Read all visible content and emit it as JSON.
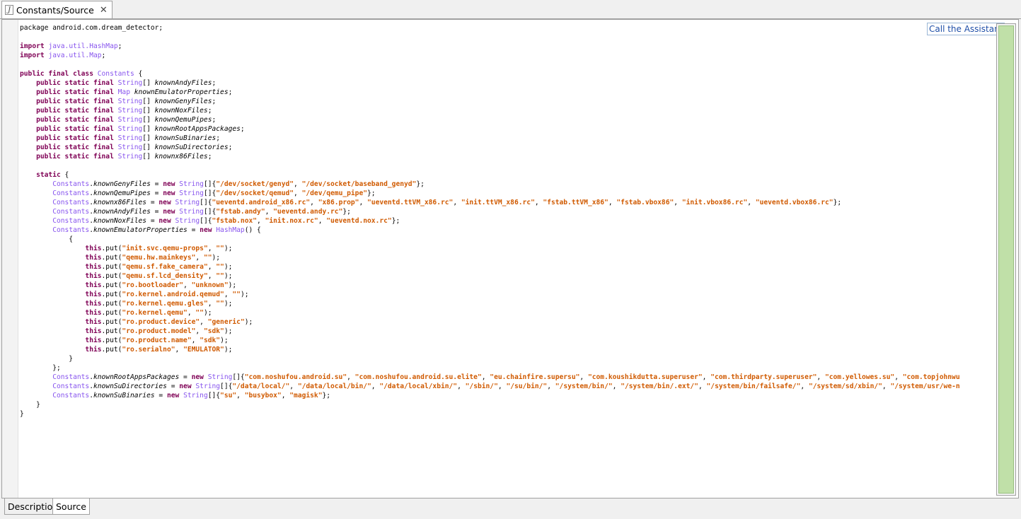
{
  "editor_tab": {
    "title": "Constants/Source",
    "icon": "java-file-icon"
  },
  "assistant": {
    "label": "Call the Assistant"
  },
  "bottom_tabs": [
    {
      "label": "Description"
    },
    {
      "label": "Source"
    }
  ],
  "code_lines": [
    [
      [
        "t",
        "package android.com.dream_detector;"
      ]
    ],
    [],
    [
      [
        "k",
        "import"
      ],
      [
        "t",
        " "
      ],
      [
        "y",
        "java.util.HashMap"
      ],
      [
        "t",
        ";"
      ]
    ],
    [
      [
        "k",
        "import"
      ],
      [
        "t",
        " "
      ],
      [
        "y",
        "java.util.Map"
      ],
      [
        "t",
        ";"
      ]
    ],
    [],
    [
      [
        "k",
        "public final class"
      ],
      [
        "t",
        " "
      ],
      [
        "y",
        "Constants"
      ],
      [
        "t",
        " {"
      ]
    ],
    [
      [
        "t",
        "    "
      ],
      [
        "k",
        "public static final"
      ],
      [
        "t",
        " "
      ],
      [
        "y",
        "String"
      ],
      [
        "t",
        "[] "
      ],
      [
        "f",
        "knownAndyFiles"
      ],
      [
        "t",
        ";"
      ]
    ],
    [
      [
        "t",
        "    "
      ],
      [
        "k",
        "public static final"
      ],
      [
        "t",
        " "
      ],
      [
        "y",
        "Map"
      ],
      [
        "t",
        " "
      ],
      [
        "f",
        "knownEmulatorProperties"
      ],
      [
        "t",
        ";"
      ]
    ],
    [
      [
        "t",
        "    "
      ],
      [
        "k",
        "public static final"
      ],
      [
        "t",
        " "
      ],
      [
        "y",
        "String"
      ],
      [
        "t",
        "[] "
      ],
      [
        "f",
        "knownGenyFiles"
      ],
      [
        "t",
        ";"
      ]
    ],
    [
      [
        "t",
        "    "
      ],
      [
        "k",
        "public static final"
      ],
      [
        "t",
        " "
      ],
      [
        "y",
        "String"
      ],
      [
        "t",
        "[] "
      ],
      [
        "f",
        "knownNoxFiles"
      ],
      [
        "t",
        ";"
      ]
    ],
    [
      [
        "t",
        "    "
      ],
      [
        "k",
        "public static final"
      ],
      [
        "t",
        " "
      ],
      [
        "y",
        "String"
      ],
      [
        "t",
        "[] "
      ],
      [
        "f",
        "knownQemuPipes"
      ],
      [
        "t",
        ";"
      ]
    ],
    [
      [
        "t",
        "    "
      ],
      [
        "k",
        "public static final"
      ],
      [
        "t",
        " "
      ],
      [
        "y",
        "String"
      ],
      [
        "t",
        "[] "
      ],
      [
        "f",
        "knownRootAppsPackages"
      ],
      [
        "t",
        ";"
      ]
    ],
    [
      [
        "t",
        "    "
      ],
      [
        "k",
        "public static final"
      ],
      [
        "t",
        " "
      ],
      [
        "y",
        "String"
      ],
      [
        "t",
        "[] "
      ],
      [
        "f",
        "knownSuBinaries"
      ],
      [
        "t",
        ";"
      ]
    ],
    [
      [
        "t",
        "    "
      ],
      [
        "k",
        "public static final"
      ],
      [
        "t",
        " "
      ],
      [
        "y",
        "String"
      ],
      [
        "t",
        "[] "
      ],
      [
        "f",
        "knownSuDirectories"
      ],
      [
        "t",
        ";"
      ]
    ],
    [
      [
        "t",
        "    "
      ],
      [
        "k",
        "public static final"
      ],
      [
        "t",
        " "
      ],
      [
        "y",
        "String"
      ],
      [
        "t",
        "[] "
      ],
      [
        "f",
        "knownx86Files"
      ],
      [
        "t",
        ";"
      ]
    ],
    [],
    [
      [
        "t",
        "    "
      ],
      [
        "k",
        "static"
      ],
      [
        "t",
        " {"
      ]
    ],
    [
      [
        "t",
        "        "
      ],
      [
        "y",
        "Constants"
      ],
      [
        "t",
        "."
      ],
      [
        "f",
        "knownGenyFiles"
      ],
      [
        "t",
        " = "
      ],
      [
        "k",
        "new"
      ],
      [
        "t",
        " "
      ],
      [
        "y",
        "String"
      ],
      [
        "t",
        "[]{"
      ],
      [
        "s",
        "\"/dev/socket/genyd\""
      ],
      [
        "t",
        ", "
      ],
      [
        "s",
        "\"/dev/socket/baseband_genyd\""
      ],
      [
        "t",
        "};"
      ]
    ],
    [
      [
        "t",
        "        "
      ],
      [
        "y",
        "Constants"
      ],
      [
        "t",
        "."
      ],
      [
        "f",
        "knownQemuPipes"
      ],
      [
        "t",
        " = "
      ],
      [
        "k",
        "new"
      ],
      [
        "t",
        " "
      ],
      [
        "y",
        "String"
      ],
      [
        "t",
        "[]{"
      ],
      [
        "s",
        "\"/dev/socket/qemud\""
      ],
      [
        "t",
        ", "
      ],
      [
        "s",
        "\"/dev/qemu_pipe\""
      ],
      [
        "t",
        "};"
      ]
    ],
    [
      [
        "t",
        "        "
      ],
      [
        "y",
        "Constants"
      ],
      [
        "t",
        "."
      ],
      [
        "f",
        "knownx86Files"
      ],
      [
        "t",
        " = "
      ],
      [
        "k",
        "new"
      ],
      [
        "t",
        " "
      ],
      [
        "y",
        "String"
      ],
      [
        "t",
        "[]{"
      ],
      [
        "s",
        "\"ueventd.android_x86.rc\""
      ],
      [
        "t",
        ", "
      ],
      [
        "s",
        "\"x86.prop\""
      ],
      [
        "t",
        ", "
      ],
      [
        "s",
        "\"ueventd.ttVM_x86.rc\""
      ],
      [
        "t",
        ", "
      ],
      [
        "s",
        "\"init.ttVM_x86.rc\""
      ],
      [
        "t",
        ", "
      ],
      [
        "s",
        "\"fstab.ttVM_x86\""
      ],
      [
        "t",
        ", "
      ],
      [
        "s",
        "\"fstab.vbox86\""
      ],
      [
        "t",
        ", "
      ],
      [
        "s",
        "\"init.vbox86.rc\""
      ],
      [
        "t",
        ", "
      ],
      [
        "s",
        "\"ueventd.vbox86.rc\""
      ],
      [
        "t",
        "};"
      ]
    ],
    [
      [
        "t",
        "        "
      ],
      [
        "y",
        "Constants"
      ],
      [
        "t",
        "."
      ],
      [
        "f",
        "knownAndyFiles"
      ],
      [
        "t",
        " = "
      ],
      [
        "k",
        "new"
      ],
      [
        "t",
        " "
      ],
      [
        "y",
        "String"
      ],
      [
        "t",
        "[]{"
      ],
      [
        "s",
        "\"fstab.andy\""
      ],
      [
        "t",
        ", "
      ],
      [
        "s",
        "\"ueventd.andy.rc\""
      ],
      [
        "t",
        "};"
      ]
    ],
    [
      [
        "t",
        "        "
      ],
      [
        "y",
        "Constants"
      ],
      [
        "t",
        "."
      ],
      [
        "f",
        "knownNoxFiles"
      ],
      [
        "t",
        " = "
      ],
      [
        "k",
        "new"
      ],
      [
        "t",
        " "
      ],
      [
        "y",
        "String"
      ],
      [
        "t",
        "[]{"
      ],
      [
        "s",
        "\"fstab.nox\""
      ],
      [
        "t",
        ", "
      ],
      [
        "s",
        "\"init.nox.rc\""
      ],
      [
        "t",
        ", "
      ],
      [
        "s",
        "\"ueventd.nox.rc\""
      ],
      [
        "t",
        "};"
      ]
    ],
    [
      [
        "t",
        "        "
      ],
      [
        "y",
        "Constants"
      ],
      [
        "t",
        "."
      ],
      [
        "f",
        "knownEmulatorProperties"
      ],
      [
        "t",
        " = "
      ],
      [
        "k",
        "new"
      ],
      [
        "t",
        " "
      ],
      [
        "y",
        "HashMap"
      ],
      [
        "t",
        "() {"
      ]
    ],
    [
      [
        "t",
        "            {"
      ]
    ],
    [
      [
        "t",
        "                "
      ],
      [
        "k",
        "this"
      ],
      [
        "t",
        ".put("
      ],
      [
        "s",
        "\"init.svc.qemu-props\""
      ],
      [
        "t",
        ", "
      ],
      [
        "s",
        "\"\""
      ],
      [
        "t",
        ");"
      ]
    ],
    [
      [
        "t",
        "                "
      ],
      [
        "k",
        "this"
      ],
      [
        "t",
        ".put("
      ],
      [
        "s",
        "\"qemu.hw.mainkeys\""
      ],
      [
        "t",
        ", "
      ],
      [
        "s",
        "\"\""
      ],
      [
        "t",
        ");"
      ]
    ],
    [
      [
        "t",
        "                "
      ],
      [
        "k",
        "this"
      ],
      [
        "t",
        ".put("
      ],
      [
        "s",
        "\"qemu.sf.fake_camera\""
      ],
      [
        "t",
        ", "
      ],
      [
        "s",
        "\"\""
      ],
      [
        "t",
        ");"
      ]
    ],
    [
      [
        "t",
        "                "
      ],
      [
        "k",
        "this"
      ],
      [
        "t",
        ".put("
      ],
      [
        "s",
        "\"qemu.sf.lcd_density\""
      ],
      [
        "t",
        ", "
      ],
      [
        "s",
        "\"\""
      ],
      [
        "t",
        ");"
      ]
    ],
    [
      [
        "t",
        "                "
      ],
      [
        "k",
        "this"
      ],
      [
        "t",
        ".put("
      ],
      [
        "s",
        "\"ro.bootloader\""
      ],
      [
        "t",
        ", "
      ],
      [
        "s",
        "\"unknown\""
      ],
      [
        "t",
        ");"
      ]
    ],
    [
      [
        "t",
        "                "
      ],
      [
        "k",
        "this"
      ],
      [
        "t",
        ".put("
      ],
      [
        "s",
        "\"ro.kernel.android.qemud\""
      ],
      [
        "t",
        ", "
      ],
      [
        "s",
        "\"\""
      ],
      [
        "t",
        ");"
      ]
    ],
    [
      [
        "t",
        "                "
      ],
      [
        "k",
        "this"
      ],
      [
        "t",
        ".put("
      ],
      [
        "s",
        "\"ro.kernel.qemu.gles\""
      ],
      [
        "t",
        ", "
      ],
      [
        "s",
        "\"\""
      ],
      [
        "t",
        ");"
      ]
    ],
    [
      [
        "t",
        "                "
      ],
      [
        "k",
        "this"
      ],
      [
        "t",
        ".put("
      ],
      [
        "s",
        "\"ro.kernel.qemu\""
      ],
      [
        "t",
        ", "
      ],
      [
        "s",
        "\"\""
      ],
      [
        "t",
        ");"
      ]
    ],
    [
      [
        "t",
        "                "
      ],
      [
        "k",
        "this"
      ],
      [
        "t",
        ".put("
      ],
      [
        "s",
        "\"ro.product.device\""
      ],
      [
        "t",
        ", "
      ],
      [
        "s",
        "\"generic\""
      ],
      [
        "t",
        ");"
      ]
    ],
    [
      [
        "t",
        "                "
      ],
      [
        "k",
        "this"
      ],
      [
        "t",
        ".put("
      ],
      [
        "s",
        "\"ro.product.model\""
      ],
      [
        "t",
        ", "
      ],
      [
        "s",
        "\"sdk\""
      ],
      [
        "t",
        ");"
      ]
    ],
    [
      [
        "t",
        "                "
      ],
      [
        "k",
        "this"
      ],
      [
        "t",
        ".put("
      ],
      [
        "s",
        "\"ro.product.name\""
      ],
      [
        "t",
        ", "
      ],
      [
        "s",
        "\"sdk\""
      ],
      [
        "t",
        ");"
      ]
    ],
    [
      [
        "t",
        "                "
      ],
      [
        "k",
        "this"
      ],
      [
        "t",
        ".put("
      ],
      [
        "s",
        "\"ro.serialno\""
      ],
      [
        "t",
        ", "
      ],
      [
        "s",
        "\"EMULATOR\""
      ],
      [
        "t",
        ");"
      ]
    ],
    [
      [
        "t",
        "            }"
      ]
    ],
    [
      [
        "t",
        "        };"
      ]
    ],
    [
      [
        "t",
        "        "
      ],
      [
        "y",
        "Constants"
      ],
      [
        "t",
        "."
      ],
      [
        "f",
        "knownRootAppsPackages"
      ],
      [
        "t",
        " = "
      ],
      [
        "k",
        "new"
      ],
      [
        "t",
        " "
      ],
      [
        "y",
        "String"
      ],
      [
        "t",
        "[]{"
      ],
      [
        "s",
        "\"com.noshufou.android.su\""
      ],
      [
        "t",
        ", "
      ],
      [
        "s",
        "\"com.noshufou.android.su.elite\""
      ],
      [
        "t",
        ", "
      ],
      [
        "s",
        "\"eu.chainfire.supersu\""
      ],
      [
        "t",
        ", "
      ],
      [
        "s",
        "\"com.koushikdutta.superuser\""
      ],
      [
        "t",
        ", "
      ],
      [
        "s",
        "\"com.thirdparty.superuser\""
      ],
      [
        "t",
        ", "
      ],
      [
        "s",
        "\"com.yellowes.su\""
      ],
      [
        "t",
        ", "
      ],
      [
        "s",
        "\"com.topjohnwu"
      ]
    ],
    [
      [
        "t",
        "        "
      ],
      [
        "y",
        "Constants"
      ],
      [
        "t",
        "."
      ],
      [
        "f",
        "knownSuDirectories"
      ],
      [
        "t",
        " = "
      ],
      [
        "k",
        "new"
      ],
      [
        "t",
        " "
      ],
      [
        "y",
        "String"
      ],
      [
        "t",
        "[]{"
      ],
      [
        "s",
        "\"/data/local/\""
      ],
      [
        "t",
        ", "
      ],
      [
        "s",
        "\"/data/local/bin/\""
      ],
      [
        "t",
        ", "
      ],
      [
        "s",
        "\"/data/local/xbin/\""
      ],
      [
        "t",
        ", "
      ],
      [
        "s",
        "\"/sbin/\""
      ],
      [
        "t",
        ", "
      ],
      [
        "s",
        "\"/su/bin/\""
      ],
      [
        "t",
        ", "
      ],
      [
        "s",
        "\"/system/bin/\""
      ],
      [
        "t",
        ", "
      ],
      [
        "s",
        "\"/system/bin/.ext/\""
      ],
      [
        "t",
        ", "
      ],
      [
        "s",
        "\"/system/bin/failsafe/\""
      ],
      [
        "t",
        ", "
      ],
      [
        "s",
        "\"/system/sd/xbin/\""
      ],
      [
        "t",
        ", "
      ],
      [
        "s",
        "\"/system/usr/we-n"
      ]
    ],
    [
      [
        "t",
        "        "
      ],
      [
        "y",
        "Constants"
      ],
      [
        "t",
        "."
      ],
      [
        "f",
        "knownSuBinaries"
      ],
      [
        "t",
        " = "
      ],
      [
        "k",
        "new"
      ],
      [
        "t",
        " "
      ],
      [
        "y",
        "String"
      ],
      [
        "t",
        "[]{"
      ],
      [
        "s",
        "\"su\""
      ],
      [
        "t",
        ", "
      ],
      [
        "s",
        "\"busybox\""
      ],
      [
        "t",
        ", "
      ],
      [
        "s",
        "\"magisk\""
      ],
      [
        "t",
        "};"
      ]
    ],
    [
      [
        "t",
        "    }"
      ]
    ],
    [
      [
        "t",
        "}"
      ]
    ],
    [],
    []
  ],
  "current_line": 45
}
